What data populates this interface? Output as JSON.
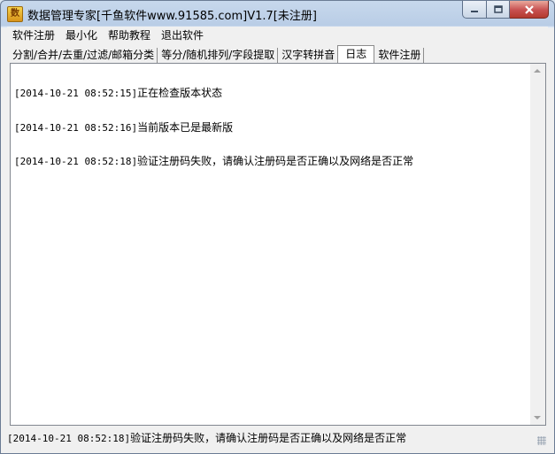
{
  "window": {
    "title": "数据管理专家[千鱼软件www.91585.com]V1.7[未注册]",
    "app_icon_glyph": "数"
  },
  "menu": [
    {
      "label": "软件注册"
    },
    {
      "label": "最小化"
    },
    {
      "label": "帮助教程"
    },
    {
      "label": "退出软件"
    }
  ],
  "tabs": [
    {
      "label": "分割/合并/去重/过滤/邮箱分类"
    },
    {
      "label": "等分/随机排列/字段提取"
    },
    {
      "label": "汉字转拼音"
    },
    {
      "label": "日志",
      "active": true
    },
    {
      "label": "软件注册"
    }
  ],
  "log": [
    {
      "time": "[2014-10-21 08:52:15]",
      "message": "正在检查版本状态"
    },
    {
      "time": "[2014-10-21 08:52:16]",
      "message": "当前版本已是最新版"
    },
    {
      "time": "[2014-10-21 08:52:18]",
      "message": "验证注册码失败，请确认注册码是否正确以及网络是否正常"
    }
  ],
  "status": {
    "time": "[2014-10-21 08:52:18]",
    "message": "验证注册码失败，请确认注册码是否正确以及网络是否正常"
  },
  "colors": {
    "close_button": "#c75050",
    "frame": "#b9cde6"
  }
}
